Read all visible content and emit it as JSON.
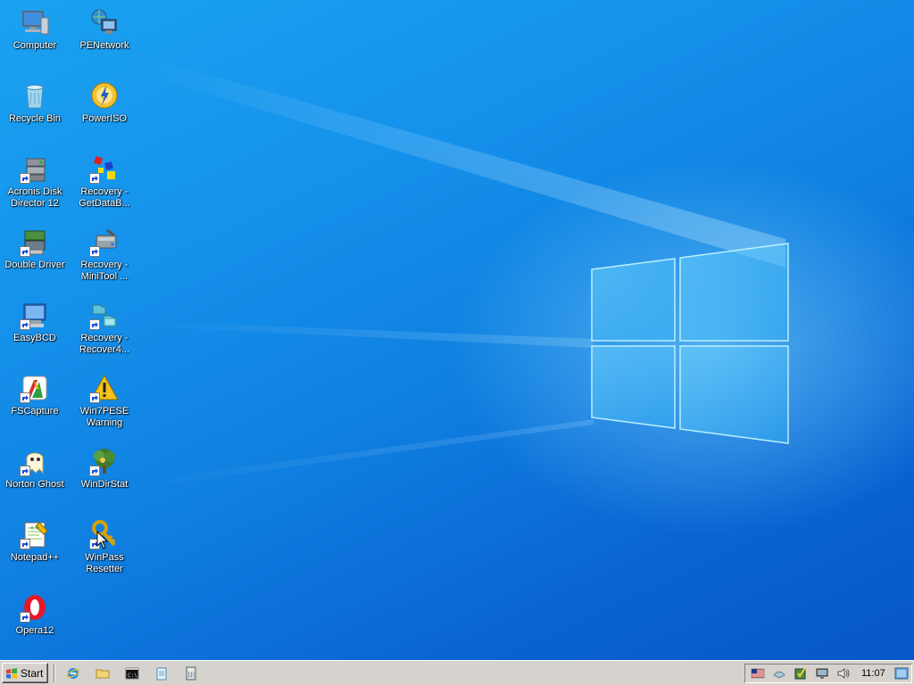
{
  "desktop": {
    "icons": [
      {
        "label": "Computer",
        "icon": "computer-icon"
      },
      {
        "label": "PENetwork",
        "icon": "network-icon"
      },
      {
        "label": "Recycle Bin",
        "icon": "recycle-bin-icon"
      },
      {
        "label": "PowerISO",
        "icon": "poweriso-icon"
      },
      {
        "label": "Acronis Disk Director 12",
        "icon": "acronis-icon"
      },
      {
        "label": "Recovery - GetDataB...",
        "icon": "getdataback-icon"
      },
      {
        "label": "Double Driver",
        "icon": "double-driver-icon"
      },
      {
        "label": "Recovery - MiniTool ...",
        "icon": "minitool-icon"
      },
      {
        "label": "EasyBCD",
        "icon": "easybcd-icon"
      },
      {
        "label": "Recovery - Recover4...",
        "icon": "recover4all-icon"
      },
      {
        "label": "FSCapture",
        "icon": "fscapture-icon"
      },
      {
        "label": "Win7PESE Warning",
        "icon": "warning-icon"
      },
      {
        "label": "Norton Ghost",
        "icon": "norton-ghost-icon"
      },
      {
        "label": "WinDirStat",
        "icon": "windirstat-icon"
      },
      {
        "label": "Notepad++",
        "icon": "notepadpp-icon"
      },
      {
        "label": "WinPass Resetter",
        "icon": "key-icon"
      },
      {
        "label": "Opera12",
        "icon": "opera-icon"
      }
    ]
  },
  "taskbar": {
    "start_label": "Start",
    "quick_launch": [
      {
        "icon": "internet-explorer-icon"
      },
      {
        "icon": "folder-icon"
      },
      {
        "icon": "command-prompt-icon"
      },
      {
        "icon": "notepad-icon"
      },
      {
        "icon": "calculator-icon"
      }
    ],
    "tray": {
      "icons": [
        "us-flag-icon",
        "network-tray-icon",
        "security-tray-icon",
        "display-tray-icon",
        "volume-icon"
      ],
      "clock": "11:07"
    }
  },
  "colors": {
    "wallpaper_light": "#1aa2f0",
    "wallpaper_dark": "#0757c6",
    "taskbar": "#d6d3ce",
    "logo_glow": "#9ee4ff"
  }
}
